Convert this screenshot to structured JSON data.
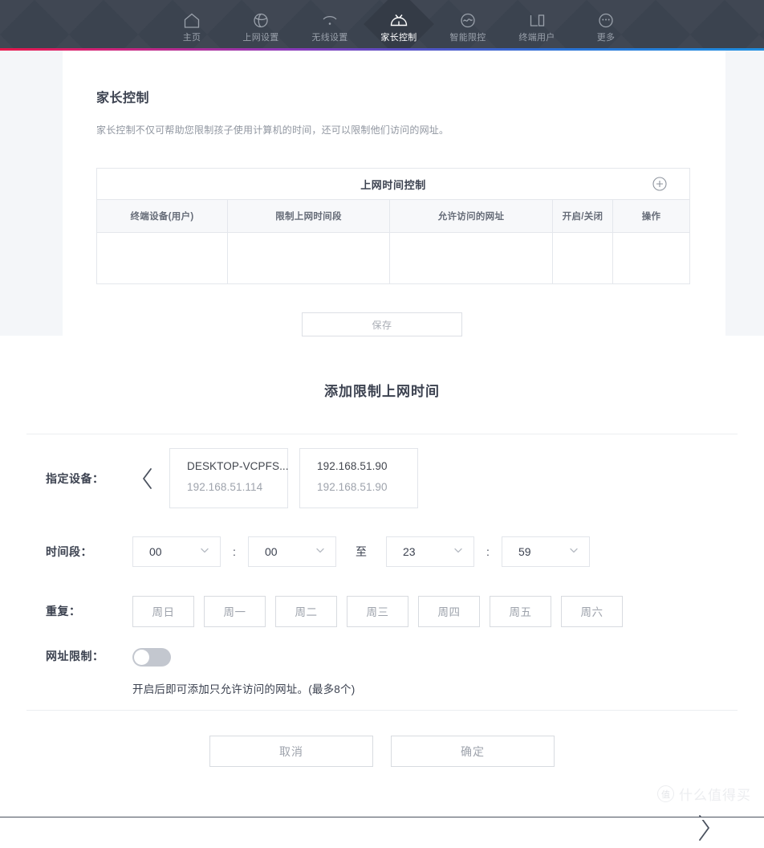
{
  "nav": {
    "items": [
      {
        "label": "主页",
        "icon": "home-icon",
        "active": false
      },
      {
        "label": "上网设置",
        "icon": "globe-icon",
        "active": false
      },
      {
        "label": "无线设置",
        "icon": "wifi-icon",
        "active": false
      },
      {
        "label": "家长控制",
        "icon": "parental-control-icon",
        "active": true
      },
      {
        "label": "智能限控",
        "icon": "wave-circle-icon",
        "active": false
      },
      {
        "label": "终端用户",
        "icon": "device-icon",
        "active": false
      },
      {
        "label": "更多",
        "icon": "more-dots-icon",
        "active": false
      }
    ]
  },
  "page": {
    "title": "家长控制",
    "description": "家长控制不仅可帮助您限制孩子使用计算机的时间，还可以限制他们访问的网址。"
  },
  "table": {
    "title": "上网时间控制",
    "add_icon": "plus-circle-icon",
    "columns": [
      "终端设备(用户)",
      "限制上网时间段",
      "允许访问的网址",
      "开启/关闭",
      "操作"
    ],
    "rows": []
  },
  "save_button": "保存",
  "dialog": {
    "title": "添加限制上网时间",
    "device_row": {
      "label": "指定设备：",
      "prev_icon": "chevron-left-icon",
      "next_icon": "chevron-right-icon",
      "devices": [
        {
          "name": "DESKTOP-VCPFS...",
          "ip": "192.168.51.114"
        },
        {
          "name": "192.168.51.90",
          "ip": "192.168.51.90"
        }
      ]
    },
    "time_row": {
      "label": "时间段：",
      "start_hour": "00",
      "start_minute": "00",
      "to_label": "至",
      "end_hour": "23",
      "end_minute": "59",
      "separator": ":",
      "chevron_icon": "chevron-down-icon"
    },
    "repeat_row": {
      "label": "重复：",
      "days": [
        "周日",
        "周一",
        "周二",
        "周三",
        "周四",
        "周五",
        "周六"
      ]
    },
    "url_row": {
      "label": "网址限制：",
      "toggle_state": "off",
      "hint": "开启后即可添加只允许访问的网址。(最多8个)"
    },
    "actions": {
      "cancel": "取消",
      "confirm": "确定"
    }
  },
  "watermark": {
    "badge": "值",
    "text": "什么值得买"
  }
}
